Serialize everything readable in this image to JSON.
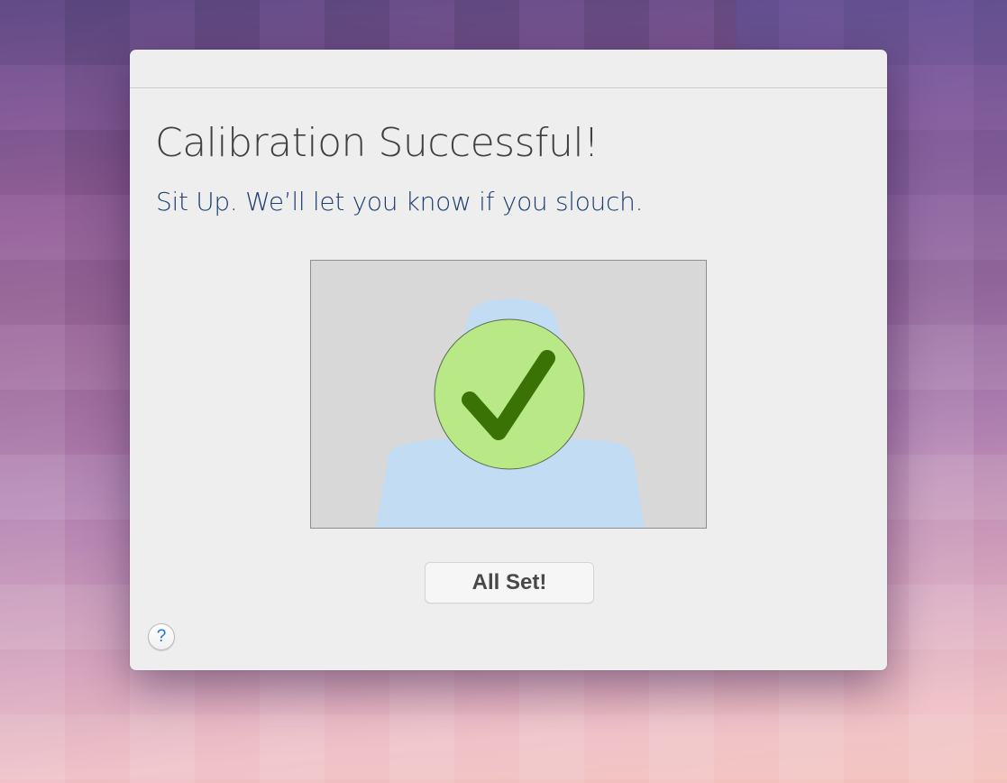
{
  "dialog": {
    "title": "Calibration Successful!",
    "subtitle": "Sit Up. We’ll let you know if you slouch.",
    "confirm_button": "All Set!",
    "help_button": "?",
    "preview": {
      "icon": "check-circle-icon",
      "silhouette": "person-silhouette-icon",
      "status": "success"
    }
  },
  "colors": {
    "heading": "#404040",
    "subtitle": "#1e3f70",
    "silhouette": "#c2dcf4",
    "check_circle": "#b9e887",
    "checkmark": "#3a7206",
    "help_icon": "#1a73d9"
  }
}
